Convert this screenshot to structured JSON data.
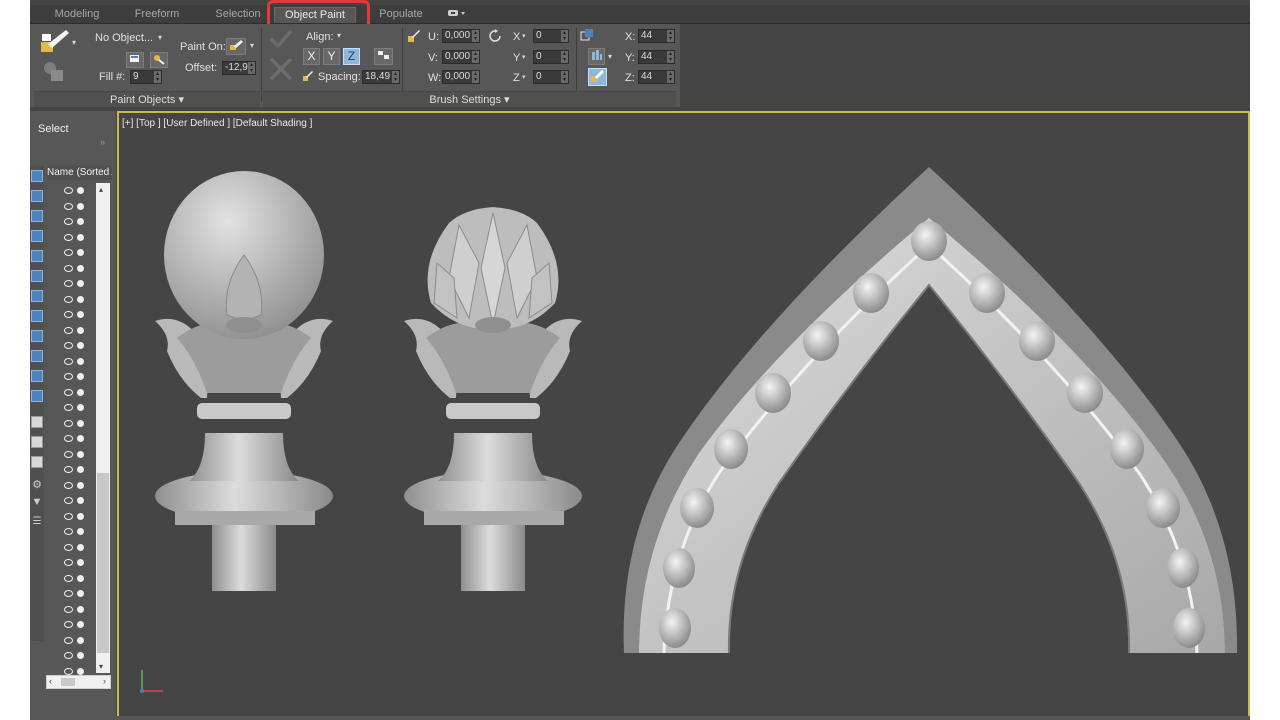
{
  "tabs": [
    {
      "label": "Modeling"
    },
    {
      "label": "Freeform"
    },
    {
      "label": "Selection"
    },
    {
      "label": "Object Paint"
    },
    {
      "label": "Populate"
    }
  ],
  "paint_objects": {
    "no_object": "No Object...",
    "fill_label": "Fill #:",
    "fill_value": "9",
    "paint_on_label": "Paint On:",
    "offset_label": "Offset:",
    "offset_value": "-12,9",
    "footer": "Paint Objects"
  },
  "brush_settings": {
    "align_label": "Align:",
    "axis_x": "X",
    "axis_y": "Y",
    "axis_z": "Z",
    "spacing_label": "Spacing:",
    "spacing_value": "18,49",
    "u_label": "U:",
    "u_value": "0,000",
    "v_label": "V:",
    "v_value": "0,000",
    "w_label": "W:",
    "w_value": "0,000",
    "rot_x_label": "X",
    "rot_x_value": "0",
    "rot_y_label": "Y",
    "rot_y_value": "0",
    "rot_z_label": "Z",
    "rot_z_value": "0",
    "scale_x_label": "X:",
    "scale_x_value": "44",
    "scale_y_label": "Y:",
    "scale_y_value": "44",
    "scale_z_label": "Z:",
    "scale_z_value": "44",
    "footer": "Brush Settings"
  },
  "explorer": {
    "select_label": "Select",
    "column_header": "Name (Sorted A"
  },
  "viewport": {
    "label": "[+] [Top ] [User Defined ] [Default Shading ]"
  },
  "colors": {
    "highlight": "#e23a36",
    "active_axis": "#8fb7d9",
    "viewport_border": "#d2b84a"
  }
}
